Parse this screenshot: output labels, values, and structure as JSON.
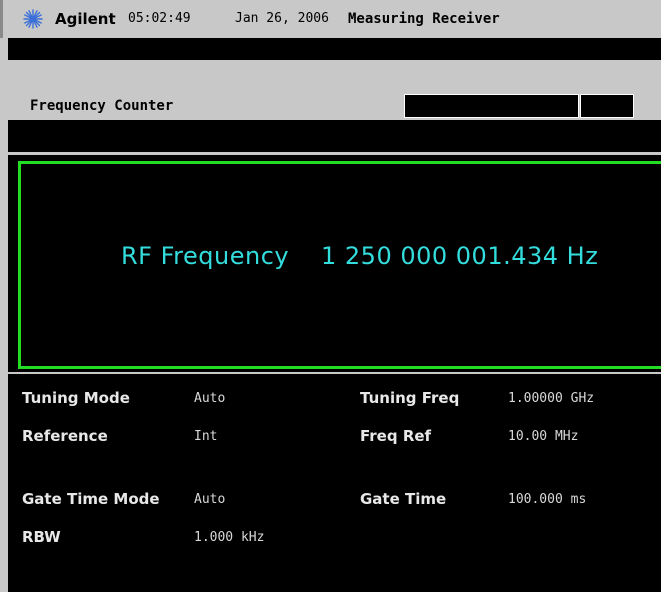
{
  "header": {
    "brand": "Agilent",
    "time": "05:02:49",
    "date": "Jan 26, 2006",
    "mode": "Measuring Receiver",
    "logo_icon": "agilent-spark-icon"
  },
  "measurement": {
    "title": "Frequency Counter"
  },
  "result": {
    "label": "RF Frequency",
    "value": "1 250 000 001.434 Hz"
  },
  "settings": {
    "tuning_mode": {
      "label": "Tuning Mode",
      "value": "Auto"
    },
    "tuning_freq": {
      "label": "Tuning Freq",
      "value": "1.00000 GHz"
    },
    "reference": {
      "label": "Reference",
      "value": "Int"
    },
    "freq_ref": {
      "label": "Freq Ref",
      "value": "10.00 MHz"
    },
    "gate_time_mode": {
      "label": "Gate Time Mode",
      "value": "Auto"
    },
    "gate_time": {
      "label": "Gate Time",
      "value": "100.000 ms"
    },
    "rbw": {
      "label": "RBW",
      "value": "1.000 kHz"
    }
  },
  "colors": {
    "display_bg": "#000000",
    "frame_gray": "#c8c8c8",
    "result_text": "#33dddd",
    "highlight_border": "#22dd22"
  }
}
